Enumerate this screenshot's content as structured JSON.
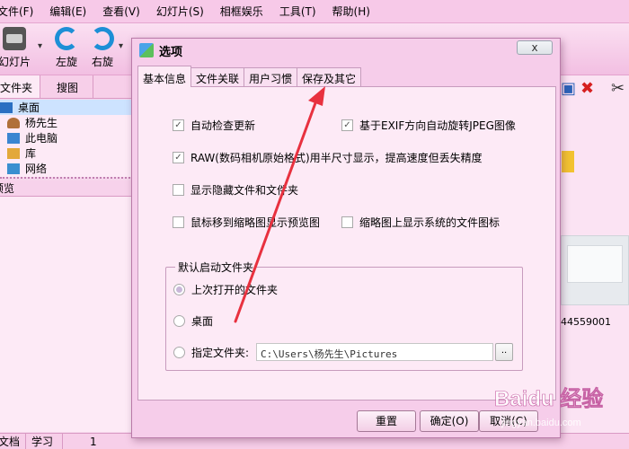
{
  "app": {
    "menu": [
      "文件(F)",
      "编辑(E)",
      "查看(V)",
      "幻灯片(S)",
      "相框娱乐",
      "工具(T)",
      "帮助(H)"
    ],
    "toolbar": {
      "slideshow": "幻灯片",
      "rotate_left": "左旋",
      "rotate_right": "右旋"
    },
    "panel_tabs": [
      "文件夹",
      "搜图"
    ],
    "tree": [
      "桌面",
      "杨先生",
      "此电脑",
      "库",
      "网络"
    ],
    "preview_header": "预览",
    "right_pane": {
      "thumb_caption": "44559001"
    },
    "statusbar": [
      "文档",
      "学习",
      "1"
    ]
  },
  "dialog": {
    "title": "选项",
    "close_label": "x",
    "tabs": [
      "基本信息",
      "文件关联",
      "用户习惯",
      "保存及其它"
    ],
    "active_tab": 0,
    "options": {
      "auto_update": {
        "label": "自动检查更新",
        "checked": true
      },
      "exif_rotate": {
        "label": "基于EXIF方向自动旋转JPEG图像",
        "checked": true
      },
      "raw_half": {
        "label": "RAW(数码相机原始格式)用半尺寸显示，提高速度但丢失精度",
        "checked": true
      },
      "show_hidden": {
        "label": "显示隐藏文件和文件夹",
        "checked": false
      },
      "hover_preview": {
        "label": "鼠标移到缩略图显示预览图",
        "checked": false
      },
      "show_sys_icon": {
        "label": "缩略图上显示系统的文件图标",
        "checked": false
      }
    },
    "startup_group": {
      "legend": "默认启动文件夹",
      "last_opened": "上次打开的文件夹",
      "desktop": "桌面",
      "specified": "指定文件夹:",
      "selected": "last_opened",
      "path": "C:\\Users\\杨先生\\Pictures",
      "browse_label": ".."
    },
    "buttons": {
      "reset": "重置",
      "ok": "确定(O)",
      "cancel": "取消(C)"
    }
  },
  "annotation": {
    "color": "#e8313f",
    "points_to": "保存及其它"
  },
  "watermark": {
    "text": "Baidu 经验",
    "sub": "jingyan.baidu.com"
  }
}
